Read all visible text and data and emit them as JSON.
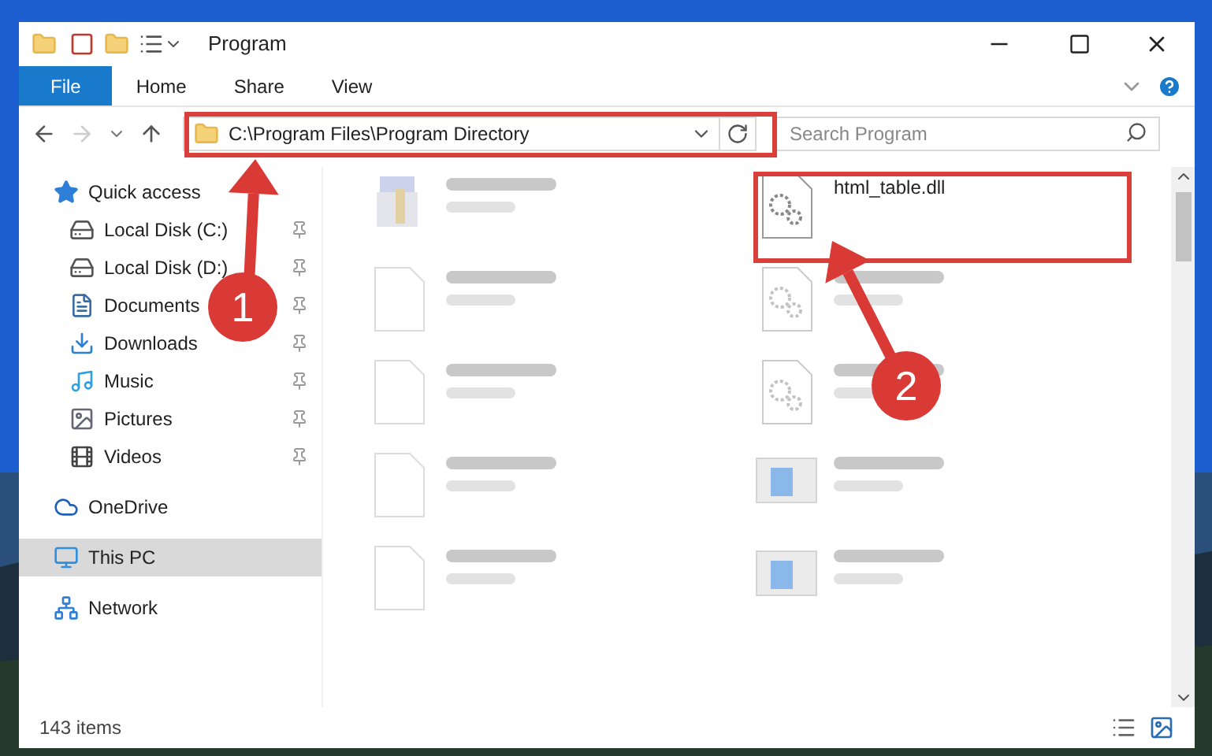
{
  "window": {
    "title": "Program"
  },
  "ribbon_tabs": [
    {
      "label": "File",
      "kind": "file"
    },
    {
      "label": "Home",
      "kind": "tab"
    },
    {
      "label": "Share",
      "kind": "tab"
    },
    {
      "label": "View",
      "kind": "tab"
    }
  ],
  "address": {
    "path": "C:\\Program Files\\Program Directory"
  },
  "search": {
    "placeholder": "Search Program"
  },
  "sidebar": {
    "items": [
      {
        "label": "Quick access",
        "kind": "star",
        "selected": false,
        "children": [
          {
            "label": "Local Disk (C:)",
            "kind": "disk",
            "pinned": true
          },
          {
            "label": "Local Disk (D:)",
            "kind": "disk",
            "pinned": true
          },
          {
            "label": "Documents",
            "kind": "doc",
            "pinned": true
          },
          {
            "label": "Downloads",
            "kind": "download",
            "pinned": true
          },
          {
            "label": "Music",
            "kind": "music",
            "pinned": true
          },
          {
            "label": "Pictures",
            "kind": "picture",
            "pinned": true
          },
          {
            "label": "Videos",
            "kind": "video",
            "pinned": true
          }
        ]
      },
      {
        "label": "OneDrive",
        "kind": "cloud",
        "selected": false
      },
      {
        "label": "This PC",
        "kind": "pc",
        "selected": true
      },
      {
        "label": "Network",
        "kind": "network",
        "selected": false
      }
    ]
  },
  "files": [
    {
      "kind": "exe",
      "blurred": true
    },
    {
      "name": "html_table.dll",
      "kind": "dll",
      "blurred": false
    },
    {
      "kind": "doc",
      "blurred": true
    },
    {
      "kind": "dll",
      "blurred": true
    },
    {
      "kind": "doc",
      "blurred": true
    },
    {
      "kind": "dll",
      "blurred": true
    },
    {
      "kind": "doc",
      "blurred": true
    },
    {
      "kind": "app",
      "blurred": true
    },
    {
      "kind": "doc",
      "blurred": true
    },
    {
      "kind": "app",
      "blurred": true
    }
  ],
  "status_bar": {
    "count": "143 items"
  },
  "annotations": [
    {
      "number": "1"
    },
    {
      "number": "2"
    }
  ]
}
